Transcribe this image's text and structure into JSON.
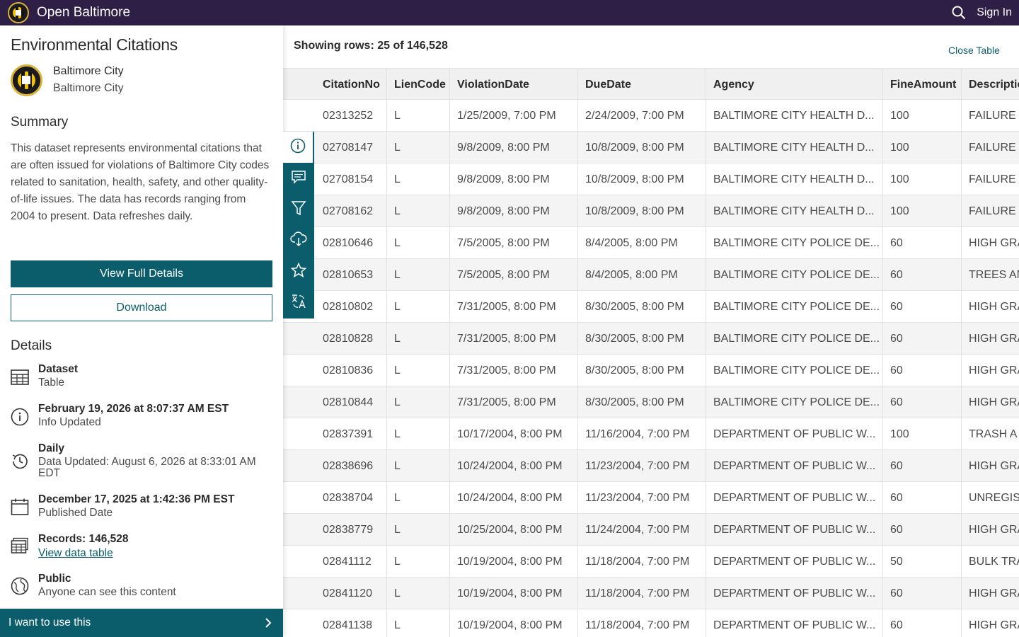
{
  "header": {
    "site_title": "Open Baltimore",
    "signin": "Sign In"
  },
  "dataset": {
    "title": "Environmental Citations",
    "owner_name": "Baltimore City",
    "owner_org": "Baltimore City",
    "summary_heading": "Summary",
    "summary": "This dataset represents environmental citations that are often issued for violations of Baltimore City codes related to sanitation, health, safety, and other quality-of-life issues. The data has records ranging from 2004 to present. Data refreshes daily.",
    "view_full_details": "View Full Details",
    "download": "Download",
    "details_heading": "Details",
    "details": {
      "type": {
        "main": "Dataset",
        "sub": "Table"
      },
      "info": {
        "main": "February 19, 2026 at 8:07:37 AM EST",
        "sub": "Info Updated"
      },
      "refresh": {
        "main": "Daily",
        "sub": "Data Updated: August 6, 2026 at 8:33:01 AM EDT"
      },
      "published": {
        "main": "December 17, 2025 at 1:42:36 PM EST",
        "sub": "Published Date"
      },
      "records": {
        "main": "Records: 146,528",
        "link": "View data table"
      },
      "access": {
        "main": "Public",
        "sub": "Anyone can see this content"
      }
    },
    "use_bar": "I want to use this"
  },
  "icons": {
    "search": "search-icon",
    "info": "info-icon",
    "comment": "comment-icon",
    "filter": "filter-icon",
    "download": "cloud-download-icon",
    "favorite": "star-icon",
    "translate": "translate-icon",
    "chevron": "chevron-right-icon"
  },
  "colors": {
    "header_bg": "#2e1f47",
    "accent": "#0b5d6b"
  },
  "table": {
    "showing": "Showing rows: 25 of 146,528",
    "close": "Close Table",
    "columns": [
      "",
      "CitationNo",
      "LienCode",
      "ViolationDate",
      "DueDate",
      "Agency",
      "FineAmount",
      "Descriptio"
    ],
    "rows": [
      [
        "02313252",
        "L",
        "1/25/2009, 7:00 PM",
        "2/24/2009, 7:00 PM",
        "BALTIMORE CITY HEALTH D...",
        "100",
        "FAILURE T"
      ],
      [
        "02708147",
        "L",
        "9/8/2009, 8:00 PM",
        "10/8/2009, 8:00 PM",
        "BALTIMORE CITY HEALTH D...",
        "100",
        "FAILURE T"
      ],
      [
        "02708154",
        "L",
        "9/8/2009, 8:00 PM",
        "10/8/2009, 8:00 PM",
        "BALTIMORE CITY HEALTH D...",
        "100",
        "FAILURE T"
      ],
      [
        "02708162",
        "L",
        "9/8/2009, 8:00 PM",
        "10/8/2009, 8:00 PM",
        "BALTIMORE CITY HEALTH D...",
        "100",
        "FAILURE T"
      ],
      [
        "02810646",
        "L",
        "7/5/2005, 8:00 PM",
        "8/4/2005, 8:00 PM",
        "BALTIMORE CITY POLICE DE...",
        "60",
        "HIGH GRA"
      ],
      [
        "02810653",
        "L",
        "7/5/2005, 8:00 PM",
        "8/4/2005, 8:00 PM",
        "BALTIMORE CITY POLICE DE...",
        "60",
        "TREES AN"
      ],
      [
        "02810802",
        "L",
        "7/31/2005, 8:00 PM",
        "8/30/2005, 8:00 PM",
        "BALTIMORE CITY POLICE DE...",
        "60",
        "HIGH GRA"
      ],
      [
        "02810828",
        "L",
        "7/31/2005, 8:00 PM",
        "8/30/2005, 8:00 PM",
        "BALTIMORE CITY POLICE DE...",
        "60",
        "HIGH GRA"
      ],
      [
        "02810836",
        "L",
        "7/31/2005, 8:00 PM",
        "8/30/2005, 8:00 PM",
        "BALTIMORE CITY POLICE DE...",
        "60",
        "HIGH GRA"
      ],
      [
        "02810844",
        "L",
        "7/31/2005, 8:00 PM",
        "8/30/2005, 8:00 PM",
        "BALTIMORE CITY POLICE DE...",
        "60",
        "HIGH GRA"
      ],
      [
        "02837391",
        "L",
        "10/17/2004, 8:00 PM",
        "11/16/2004, 7:00 PM",
        "DEPARTMENT OF PUBLIC W...",
        "100",
        "TRASH A"
      ],
      [
        "02838696",
        "L",
        "10/24/2004, 8:00 PM",
        "11/23/2004, 7:00 PM",
        "DEPARTMENT OF PUBLIC W...",
        "60",
        "HIGH GRA"
      ],
      [
        "02838704",
        "L",
        "10/24/2004, 8:00 PM",
        "11/23/2004, 7:00 PM",
        "DEPARTMENT OF PUBLIC W...",
        "60",
        "UNREGIST"
      ],
      [
        "02838779",
        "L",
        "10/25/2004, 8:00 PM",
        "11/24/2004, 7:00 PM",
        "DEPARTMENT OF PUBLIC W...",
        "60",
        "HIGH GRA"
      ],
      [
        "02841112",
        "L",
        "10/19/2004, 8:00 PM",
        "11/18/2004, 7:00 PM",
        "DEPARTMENT OF PUBLIC W...",
        "50",
        "BULK TRA"
      ],
      [
        "02841120",
        "L",
        "10/19/2004, 8:00 PM",
        "11/18/2004, 7:00 PM",
        "DEPARTMENT OF PUBLIC W...",
        "60",
        "HIGH GRA"
      ],
      [
        "02841138",
        "L",
        "10/19/2004, 8:00 PM",
        "11/18/2004, 7:00 PM",
        "DEPARTMENT OF PUBLIC W...",
        "60",
        "HIGH GRA"
      ]
    ]
  }
}
